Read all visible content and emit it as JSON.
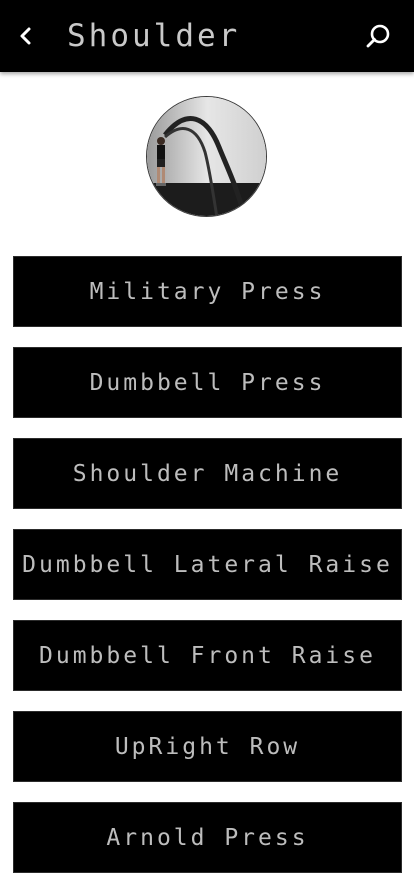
{
  "header": {
    "title": "Shoulder",
    "back_icon": "chevron-left-icon",
    "search_icon": "search-icon"
  },
  "hero": {
    "image": "woman-battle-ropes-photo"
  },
  "exercises": [
    {
      "label": "Military Press"
    },
    {
      "label": "Dumbbell Press"
    },
    {
      "label": "Shoulder Machine"
    },
    {
      "label": "Dumbbell Lateral Raise"
    },
    {
      "label": "Dumbbell Front Raise"
    },
    {
      "label": "UpRight Row"
    },
    {
      "label": "Arnold Press"
    }
  ],
  "colors": {
    "app_bar": "#000000",
    "button_bg": "#000000",
    "button_text": "#bdbdbd",
    "title_text": "#c9c9c9",
    "page_bg": "#ffffff"
  }
}
